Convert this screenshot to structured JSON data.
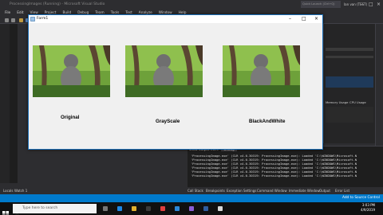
{
  "vs": {
    "title": "ProcessingImages (Running) - Microsoft Visual Studio",
    "user": "Ian van (TEST)",
    "menu": [
      "File",
      "Edit",
      "View",
      "Project",
      "Build",
      "Debug",
      "Team",
      "Tools",
      "Test",
      "Analyze",
      "Window",
      "Help"
    ],
    "quick_launch": "Quick Launch (Ctrl+Q)",
    "output_header": "Show output from:",
    "output_source": "Debug",
    "output_lines": [
      "'ProcessingImage.exe' (CLR v4.0.30319: ProcessingImage.exe): Loaded 'C:\\WINDOWS\\Microsoft.N",
      "'ProcessingImage.exe' (CLR v4.0.30319: ProcessingImage.exe): Loaded 'C:\\WINDOWS\\Microsoft.N",
      "'ProcessingImage.exe' (CLR v4.0.30319: ProcessingImage.exe): Loaded 'C:\\WINDOWS\\Microsoft.N",
      "'ProcessingImage.exe' (CLR v4.0.30319: ProcessingImage.exe): Loaded 'C:\\WINDOWS\\Microsoft.N",
      "'ProcessingImage.exe' (CLR v4.0.30319: ProcessingImage.exe): Loaded 'C:\\WINDOWS\\Microsoft.N",
      "'ProcessingImage.exe' (CLR v4.0.30319: ProcessingImage.exe): Loaded 'C:\\WINDOWS\\Microsoft.N"
    ],
    "bottom_tabs": [
      "Locals",
      "Watch 1",
      "Call Stack",
      "Breakpoints",
      "Exception Settings",
      "Command Window",
      "Immediate Window",
      "Output",
      "Error List"
    ],
    "right_tabs": [
      "Memory Usage",
      "CPU Usage"
    ],
    "status_add": "Add to Source Control"
  },
  "form": {
    "title": "Form1",
    "captions": [
      "Original",
      "GrayScale",
      "BlackAndWhite"
    ]
  },
  "taskbar": {
    "search_placeholder": "Type here to search",
    "time": "3:03 PM",
    "date": "4/9/2019"
  }
}
